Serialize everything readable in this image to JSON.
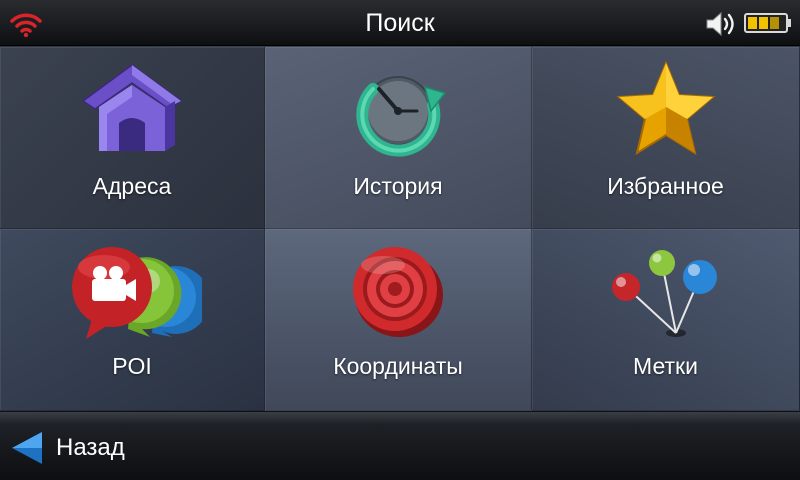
{
  "header": {
    "title": "Поиск",
    "icons": {
      "signal": "wifi-signal-icon",
      "volume": "speaker-volume-icon",
      "battery": "battery-icon"
    }
  },
  "menu": {
    "items": [
      {
        "label": "Адреса",
        "icon": "house-icon"
      },
      {
        "label": "История",
        "icon": "history-clock-icon"
      },
      {
        "label": "Избранное",
        "icon": "star-icon"
      },
      {
        "label": "POI",
        "icon": "poi-bubbles-icon"
      },
      {
        "label": "Координаты",
        "icon": "target-icon"
      },
      {
        "label": "Метки",
        "icon": "pins-icon"
      }
    ]
  },
  "footer": {
    "back_label": "Назад",
    "back_icon": "back-arrow-icon"
  },
  "colors": {
    "accent_blue": "#2a8fe0",
    "wifi_red": "#d8242a",
    "battery_yellow": "#f2c200"
  }
}
